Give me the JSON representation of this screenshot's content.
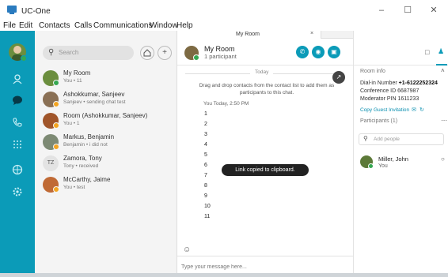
{
  "window": {
    "title": "UC-One",
    "controls": [
      "–",
      "☐",
      "✕"
    ]
  },
  "menu": [
    "File",
    "Edit",
    "Contacts",
    "Calls",
    "Communications",
    "Window",
    "Help"
  ],
  "colors": {
    "accent": "#0b9bb8",
    "presence_available": "#35a852",
    "presence_busy": "#f4a521"
  },
  "nav": {
    "icons": [
      "contacts-icon",
      "chat-icon",
      "calls-icon",
      "dialpad-icon",
      "meetings-icon",
      "settings-icon"
    ]
  },
  "search": {
    "placeholder": "Search"
  },
  "conversations": [
    {
      "name": "My Room",
      "preview": "You • 11",
      "presence": "available"
    },
    {
      "name": "Ashokkumar, Sanjeev",
      "preview": "Sanjeev • sending chat test",
      "presence": "busy"
    },
    {
      "name": "Room (Ashokkumar, Sanjeev)",
      "preview": "You • 1",
      "presence": "busy"
    },
    {
      "name": "Markus, Benjamin",
      "preview": "Benjamin • i did not",
      "presence": "busy"
    },
    {
      "name": "Zamora, Tony",
      "initials": "TZ",
      "preview": "Tony • received",
      "presence": "none"
    },
    {
      "name": "McCarthy, Jaime",
      "preview": "You • test",
      "presence": "busy"
    }
  ],
  "tab": {
    "title": "My Room",
    "close": "×"
  },
  "room": {
    "name": "My Room",
    "participants": "1 participant"
  },
  "chat": {
    "day_label": "Today",
    "hint": "Drag and drop contacts from the contact list to add them as participants to this chat.",
    "meta": "You  Today, 2:50 PM",
    "lines": [
      "1",
      "2",
      "3",
      "4",
      "5",
      "6",
      "7",
      "8",
      "9",
      "10",
      "11"
    ],
    "toast": "Link copied to clipboard.",
    "composer_placeholder": "Type your message here..."
  },
  "room_info": {
    "title": "Room info",
    "dialin_label": "Dial-in Number",
    "dialin_number": "+1-6122252324",
    "conference_label": "Conference ID",
    "conference_id": "6687987",
    "moderator_label": "Moderator PIN",
    "moderator_pin": "1611233",
    "copy_invitation": "Copy Guest Invitation",
    "participants_title": "Participants (1)",
    "add_people_placeholder": "Add people",
    "participant": {
      "name": "Miller, John",
      "sub": "You"
    }
  }
}
